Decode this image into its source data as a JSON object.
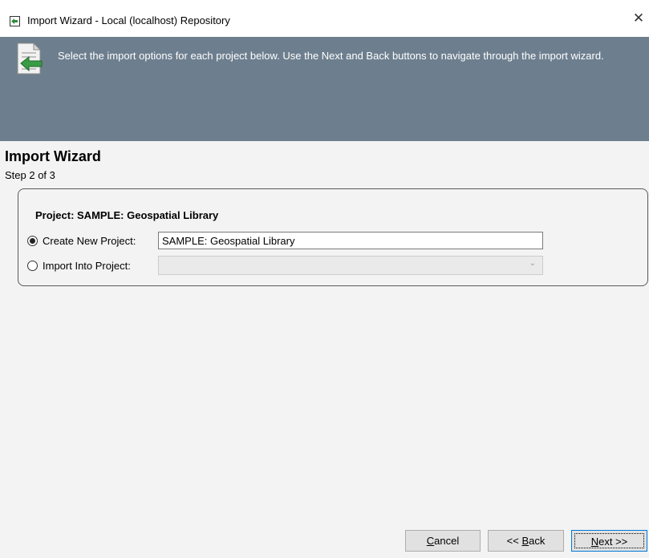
{
  "window": {
    "title": "Import Wizard - Local  (localhost) Repository",
    "close_glyph": "✕"
  },
  "banner": {
    "text": "Select the import options for each project below. Use the Next and Back buttons to navigate through the import wizard.",
    "icon": "document-import-icon",
    "background": "#6d7f8f"
  },
  "wizard": {
    "title": "Import Wizard",
    "step": "Step 2 of 3"
  },
  "project": {
    "label": "Project: SAMPLE: Geospatial Library",
    "create_new": {
      "label": "Create New Project:",
      "selected": true,
      "value": "SAMPLE: Geospatial Library"
    },
    "import_into": {
      "label": "Import Into Project:",
      "selected": false,
      "value": ""
    }
  },
  "buttons": {
    "cancel_pre": "",
    "cancel_key": "C",
    "cancel_post": "ancel",
    "back_pre": "<< ",
    "back_key": "B",
    "back_post": "ack",
    "next_pre": "",
    "next_key": "N",
    "next_post": "ext >>"
  }
}
